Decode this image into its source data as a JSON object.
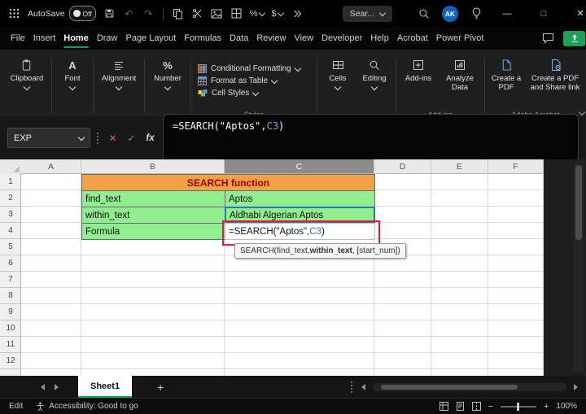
{
  "titlebar": {
    "autosave_label": "AutoSave",
    "autosave_state": "Off",
    "search_text": "Sear...",
    "avatar_initials": "AK",
    "window": {
      "minimize": "—",
      "maximize": "□",
      "close": "✕"
    }
  },
  "menubar": {
    "items": [
      "File",
      "Insert",
      "Home",
      "Draw",
      "Page Layout",
      "Formulas",
      "Data",
      "Review",
      "View",
      "Developer",
      "Help",
      "Acrobat",
      "Power Pivot"
    ],
    "active_item": "Home"
  },
  "ribbon": {
    "groups": [
      {
        "label": "Clipboard"
      },
      {
        "label": "Font"
      },
      {
        "label": "Alignment"
      },
      {
        "label": "Number"
      },
      {
        "label": "Cells"
      },
      {
        "label": "Editing"
      }
    ],
    "styles_group": {
      "buttons": [
        "Conditional Formatting",
        "Format as Table",
        "Cell Styles"
      ],
      "label": "Styles"
    },
    "addins_group": {
      "buttons": [
        "Add-ins",
        "Analyze Data"
      ],
      "label": "Add-ins"
    },
    "acrobat_group": {
      "buttons": [
        "Create a PDF",
        "Create a PDF and Share link"
      ],
      "label": "Adobe Acrobat"
    }
  },
  "formula_bar": {
    "name_box": "EXP",
    "cancel_glyph": "✕",
    "enter_glyph": "✓",
    "fx_label": "fx"
  },
  "formula": {
    "prefix": "=SEARCH(\"Aptos\",",
    "ref": "C3",
    "suffix": ")"
  },
  "sheet": {
    "column_headers": [
      "A",
      "B",
      "C",
      "D",
      "E",
      "F"
    ],
    "active_column": "C",
    "row_headers": [
      "1",
      "2",
      "3",
      "4",
      "5",
      "6",
      "7",
      "8",
      "9",
      "10",
      "11",
      "12"
    ],
    "cells": {
      "title": "SEARCH function",
      "find_text_label": "find_text",
      "find_text_value": "Aptos",
      "within_text_label": "within_text",
      "within_text_value": "Aldhabi Algerian Aptos",
      "formula_label": "Formula"
    },
    "tooltip": {
      "pre": "SEARCH(find_text, ",
      "bold": "within_text",
      "post": ", [start_num])"
    }
  },
  "tabs": {
    "sheet_name": "Sheet1",
    "add_label": "+"
  },
  "statusbar": {
    "mode": "Edit",
    "accessibility": "Accessibility: Good to go",
    "zoom_out": "−",
    "zoom_in": "+",
    "zoom": "100%"
  },
  "colors": {
    "accent_green": "#1EA05A",
    "cell_green": "#90EE90",
    "header_orange": "#F2A144",
    "title_text_red": "#9C0006",
    "ref_blue": "#2E75B6",
    "annotation_red": "#E8192C"
  }
}
